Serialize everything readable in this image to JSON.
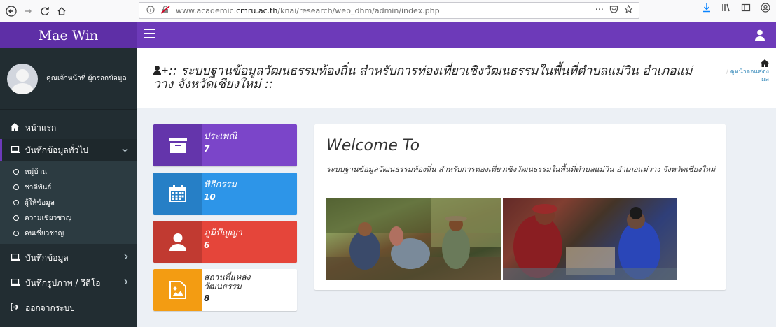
{
  "browser": {
    "back_icon": "back-arrow-icon",
    "forward_icon": "forward-arrow-icon",
    "url_prefix": "www.academic.",
    "url_domain": "cmru.ac.th",
    "url_path": "/knai/research/web_dhm/admin/index.php",
    "url_more": "···"
  },
  "app": {
    "brand": "Mae Win",
    "colors": {
      "primary": "#6d3ab9",
      "sidebar": "#222d32"
    }
  },
  "sidebar": {
    "user_name": "คุณเจ้าหน้าที่ ผู้กรอกข้อมูล",
    "items": [
      {
        "label": "หน้าแรก",
        "icon": "home-icon"
      },
      {
        "label": "บันทึกข้อมูลทั่วไป",
        "icon": "laptop-icon",
        "active": true,
        "expanded": true
      },
      {
        "label": "บันทึกข้อมูล",
        "icon": "laptop-icon"
      },
      {
        "label": "บันทึกรูปภาพ / วีดีโอ",
        "icon": "laptop-icon"
      },
      {
        "label": "ออกจากระบบ",
        "icon": "sign-out-icon"
      }
    ],
    "subitems": [
      {
        "label": "หมู่บ้าน"
      },
      {
        "label": "ชาติพันธ์"
      },
      {
        "label": "ผู้ให้ข้อมูล"
      },
      {
        "label": "ความเชี่ยวชาญ"
      },
      {
        "label": "คนเชี่ยวชาญ"
      }
    ]
  },
  "header": {
    "title_prefix": ":: ",
    "title": "ระบบฐานข้อมูลวัฒนธรรมท้องถิ่น สำหรับการท่องเที่ยวเชิงวัฒนธรรมในพื้นที่ตำบลแม่วิน อำเภอแม่วาง จังหวัดเชียงใหม่ ::",
    "breadcrumb": "ดูหน้าจอแสดงผล"
  },
  "info_boxes": [
    {
      "label": "ประเพณี",
      "value": "7",
      "icon": "archive-icon",
      "color": "#7b45c9"
    },
    {
      "label": "พิธีกรรม",
      "value": "10",
      "icon": "calendar-icon",
      "color": "#2d95e8"
    },
    {
      "label": "ภูมิปัญญา",
      "value": "6",
      "icon": "user-icon",
      "color": "#e5453a"
    },
    {
      "label": "สถานที่แหล่งวัฒนธรรม",
      "value": "8",
      "icon": "image-icon",
      "color": "#f39c12"
    }
  ],
  "welcome": {
    "title": "Welcome To",
    "text": "ระบบฐานข้อมูลวัฒนธรรมท้องถิ่น สำหรับการท่องเที่ยวเชิงวัฒนธรรมในพื้นที่ตำบลแม่วิน อำเภอแม่วาง จังหวัดเชียงใหม่"
  }
}
